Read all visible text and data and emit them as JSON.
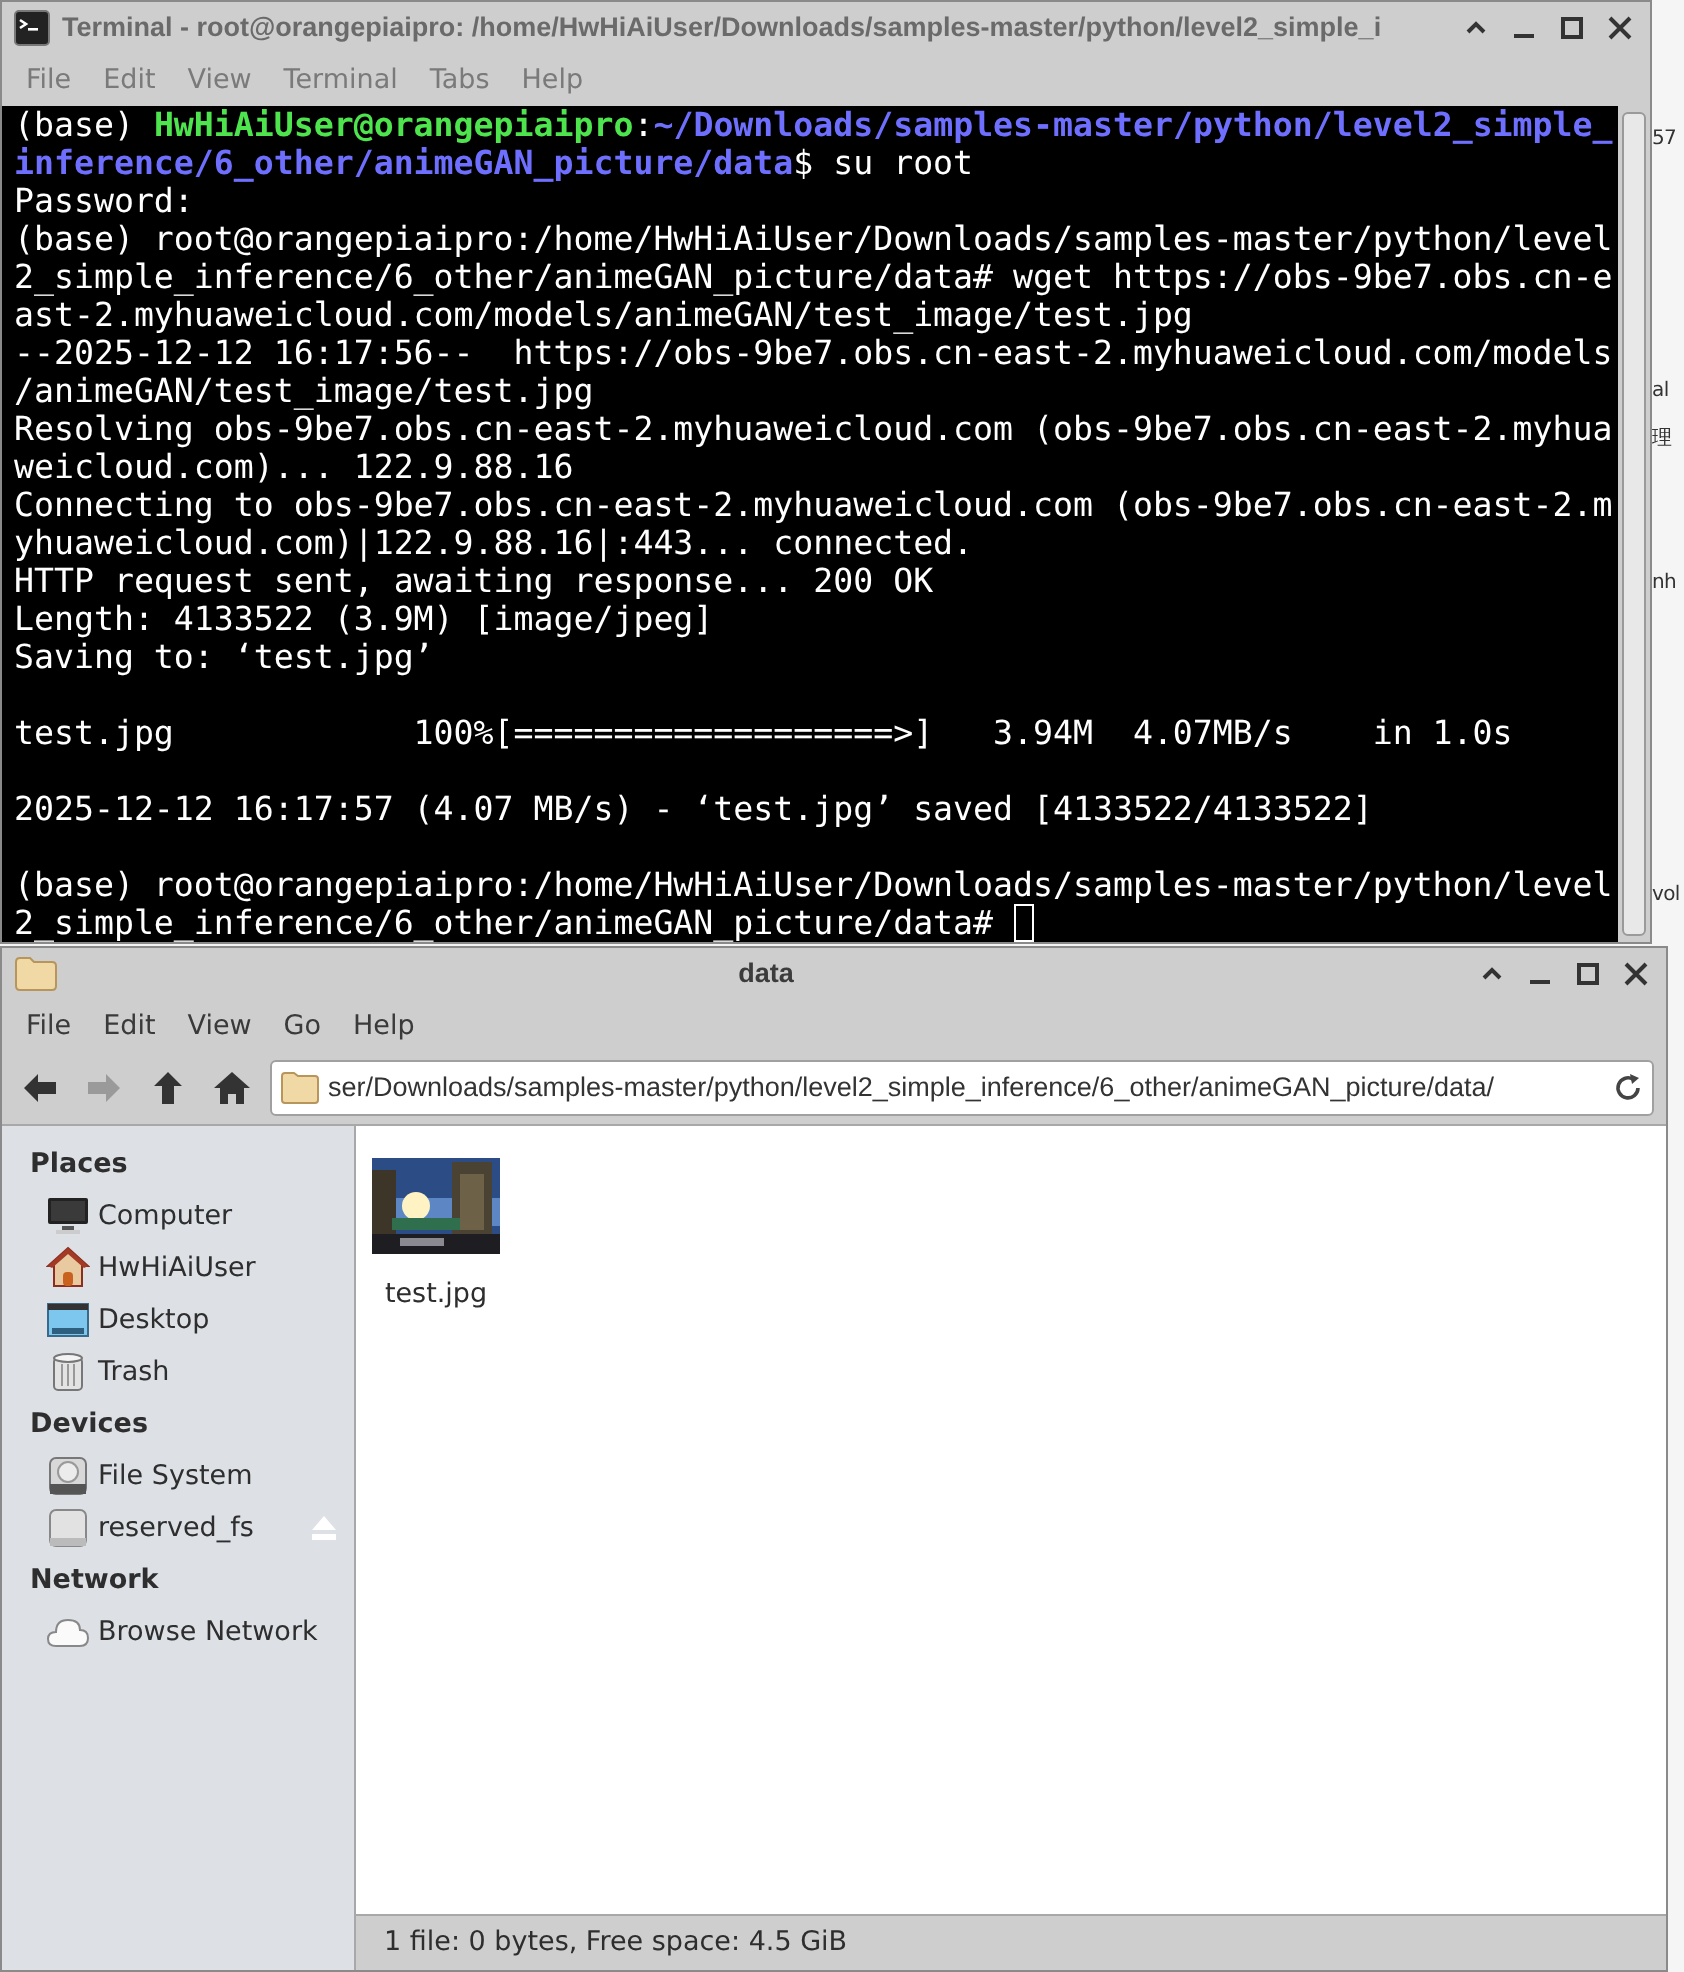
{
  "terminal": {
    "title": "Terminal - root@orangepiaipro: /home/HwHiAiUser/Downloads/samples-master/python/level2_simple_i",
    "menu": [
      "File",
      "Edit",
      "View",
      "Terminal",
      "Tabs",
      "Help"
    ],
    "lines": [
      {
        "kind": "prompt",
        "spans": [
          {
            "kind": "plain",
            "text": "(base) "
          },
          {
            "kind": "user",
            "text": "HwHiAiUser@orangepiaipro"
          },
          {
            "kind": "plain",
            "text": ":"
          },
          {
            "kind": "path",
            "text": "~/Downloads/samples-master/python/level2_simple_"
          }
        ]
      },
      {
        "kind": "prompt",
        "spans": [
          {
            "kind": "path",
            "text": "inference/6_other/animeGAN_picture/data"
          },
          {
            "kind": "plain",
            "text": "$ su root"
          }
        ]
      },
      {
        "kind": "text",
        "text": "Password:"
      },
      {
        "kind": "text",
        "text": "(base) root@orangepiaipro:/home/HwHiAiUser/Downloads/samples-master/python/level"
      },
      {
        "kind": "text",
        "text": "2_simple_inference/6_other/animeGAN_picture/data# wget https://obs-9be7.obs.cn-e"
      },
      {
        "kind": "text",
        "text": "ast-2.myhuaweicloud.com/models/animeGAN/test_image/test.jpg"
      },
      {
        "kind": "text",
        "text": "--2025-12-12 16:17:56--  https://obs-9be7.obs.cn-east-2.myhuaweicloud.com/models"
      },
      {
        "kind": "text",
        "text": "/animeGAN/test_image/test.jpg"
      },
      {
        "kind": "text",
        "text": "Resolving obs-9be7.obs.cn-east-2.myhuaweicloud.com (obs-9be7.obs.cn-east-2.myhua"
      },
      {
        "kind": "text",
        "text": "weicloud.com)... 122.9.88.16"
      },
      {
        "kind": "text",
        "text": "Connecting to obs-9be7.obs.cn-east-2.myhuaweicloud.com (obs-9be7.obs.cn-east-2.m"
      },
      {
        "kind": "text",
        "text": "yhuaweicloud.com)|122.9.88.16|:443... connected."
      },
      {
        "kind": "text",
        "text": "HTTP request sent, awaiting response... 200 OK"
      },
      {
        "kind": "text",
        "text": "Length: 4133522 (3.9M) [image/jpeg]"
      },
      {
        "kind": "text",
        "text": "Saving to: ‘test.jpg’"
      },
      {
        "kind": "blank"
      },
      {
        "kind": "text",
        "text": "test.jpg            100%[===================>]   3.94M  4.07MB/s    in 1.0s"
      },
      {
        "kind": "blank"
      },
      {
        "kind": "text",
        "text": "2025-12-12 16:17:57 (4.07 MB/s) - ‘test.jpg’ saved [4133522/4133522]"
      },
      {
        "kind": "blank"
      },
      {
        "kind": "text",
        "text": "(base) root@orangepiaipro:/home/HwHiAiUser/Downloads/samples-master/python/level"
      },
      {
        "kind": "text",
        "text": "2_simple_inference/6_other/animeGAN_picture/data# ",
        "cursor": true
      }
    ]
  },
  "file_manager": {
    "title": "data",
    "menu": [
      "File",
      "Edit",
      "View",
      "Go",
      "Help"
    ],
    "toolbar": [
      {
        "kind": "back",
        "disabled": false
      },
      {
        "kind": "forward",
        "disabled": true
      },
      {
        "kind": "up",
        "disabled": false
      },
      {
        "kind": "home",
        "disabled": false
      }
    ],
    "location": "ser/Downloads/samples-master/python/level2_simple_inference/6_other/animeGAN_picture/data/",
    "sidebar": [
      {
        "heading": "Places",
        "items": [
          {
            "label": "Computer",
            "kind": "computer",
            "eject": false
          },
          {
            "label": "HwHiAiUser",
            "kind": "home",
            "eject": false
          },
          {
            "label": "Desktop",
            "kind": "desktop",
            "eject": false
          },
          {
            "label": "Trash",
            "kind": "trash",
            "eject": false
          }
        ]
      },
      {
        "heading": "Devices",
        "items": [
          {
            "label": "File System",
            "kind": "disk",
            "eject": false
          },
          {
            "label": "reserved_fs",
            "kind": "drive",
            "eject": true
          }
        ]
      },
      {
        "heading": "Network",
        "items": [
          {
            "label": "Browse Network",
            "kind": "network",
            "eject": false
          }
        ]
      }
    ],
    "files": [
      {
        "name": "test.jpg",
        "kind": "picture"
      }
    ],
    "status_bar": "1 file: 0 bytes, Free space: 4.5 GiB"
  },
  "background_fragments": [
    "57",
    "al",
    "理",
    "nh",
    "vol"
  ]
}
